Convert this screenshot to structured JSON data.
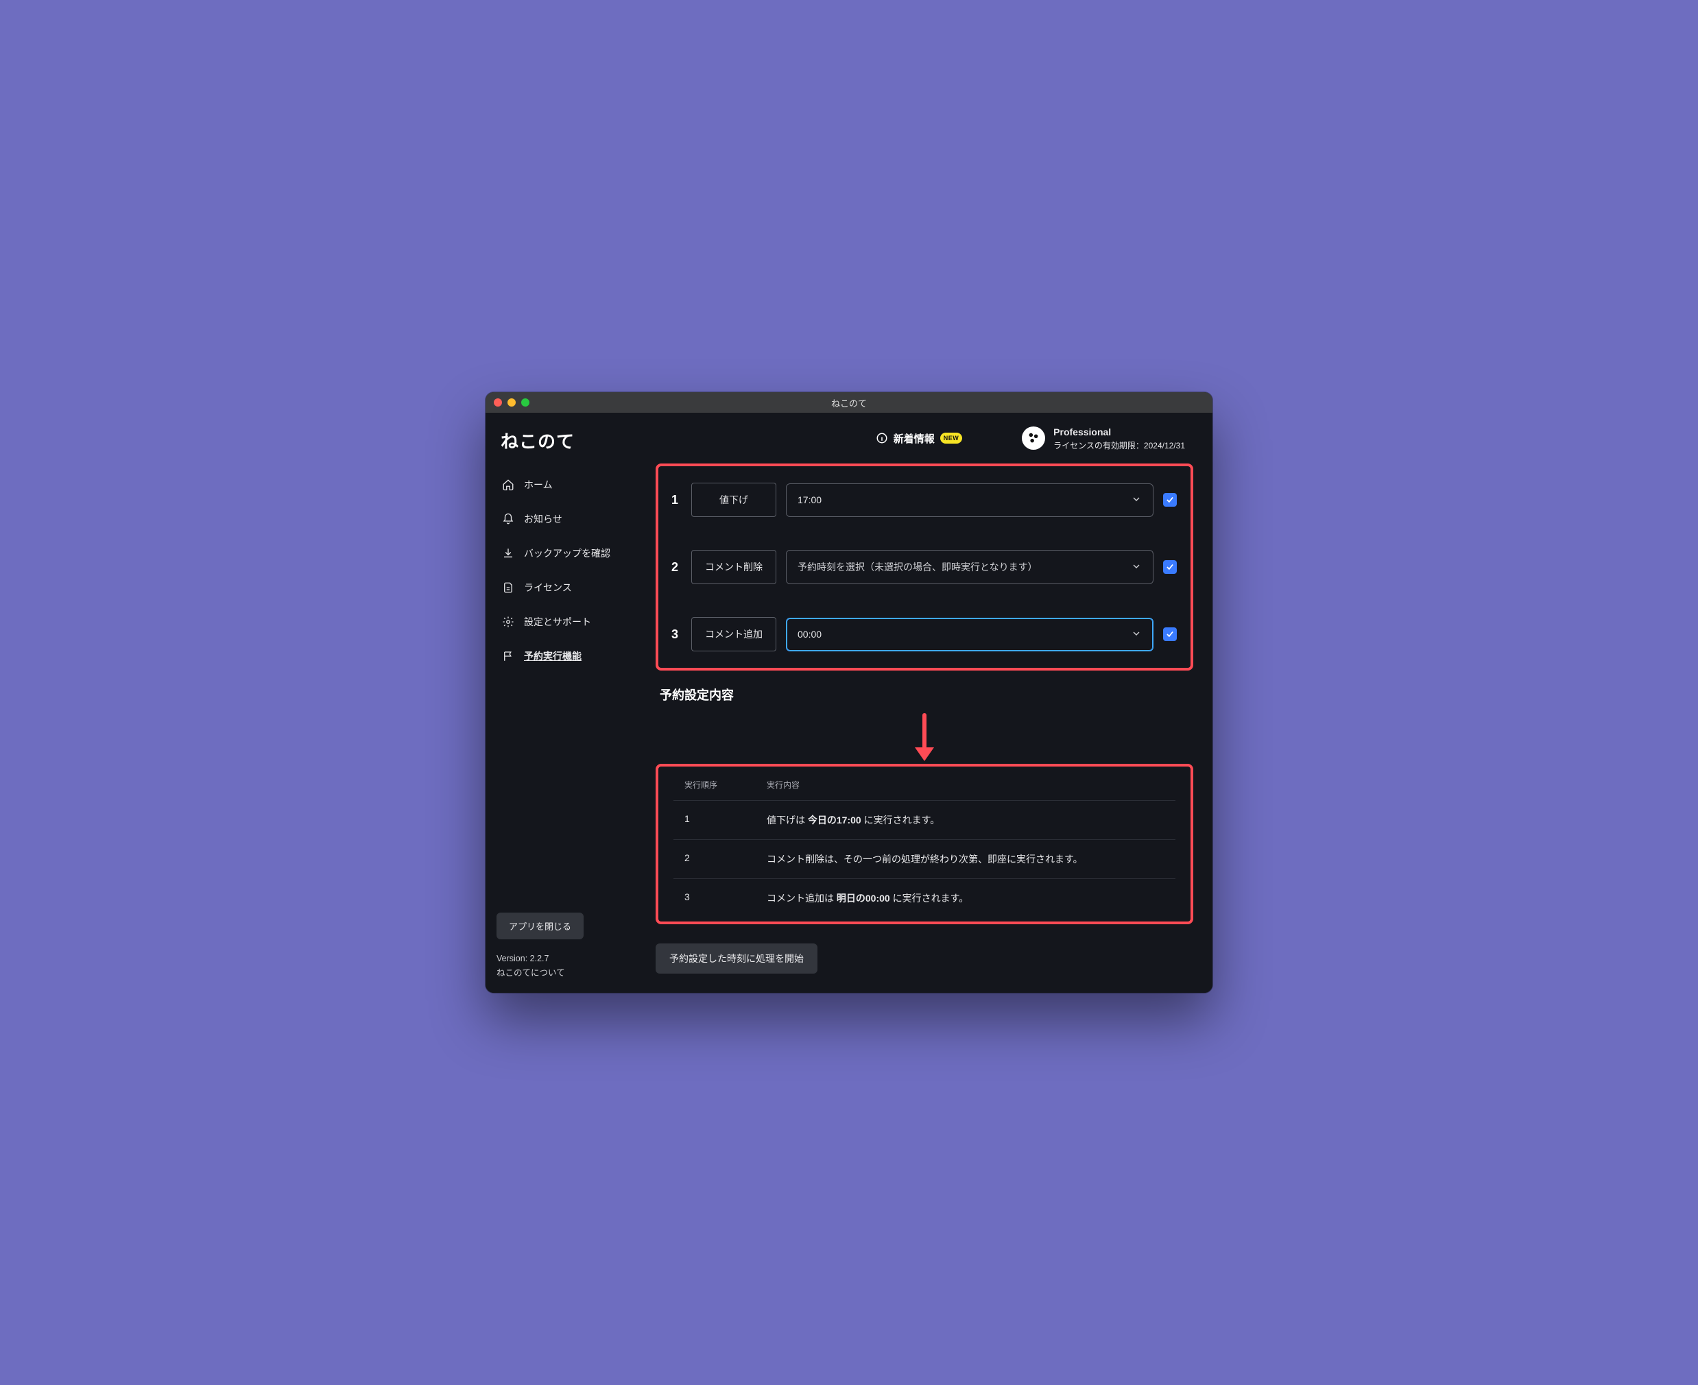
{
  "window": {
    "title": "ねこのて"
  },
  "app": {
    "title": "ねこのて"
  },
  "sidebar": {
    "items": [
      {
        "label": "ホーム"
      },
      {
        "label": "お知らせ"
      },
      {
        "label": "バックアップを確認"
      },
      {
        "label": "ライセンス"
      },
      {
        "label": "設定とサポート"
      },
      {
        "label": "予約実行機能"
      }
    ],
    "close_label": "アプリを閉じる",
    "version_label": "Version: 2.2.7",
    "about_label": "ねこのてについて"
  },
  "header": {
    "news_label": "新着情報",
    "badge": "NEW",
    "plan_name": "Professional",
    "license_expiry": "ライセンスの有効期限：2024/12/31"
  },
  "scheduler": {
    "rows": [
      {
        "num": "1",
        "type": "値下げ",
        "time": "17:00",
        "checked": true,
        "focused": false,
        "placeholder": false
      },
      {
        "num": "2",
        "type": "コメント削除",
        "time": "予約時刻を選択（未選択の場合、即時実行となります）",
        "checked": true,
        "focused": false,
        "placeholder": true
      },
      {
        "num": "3",
        "type": "コメント追加",
        "time": "00:00",
        "checked": true,
        "focused": true,
        "placeholder": false
      }
    ]
  },
  "summary": {
    "title": "予約設定内容",
    "head_order": "実行順序",
    "head_content": "実行内容",
    "rows": [
      {
        "num": "1",
        "text_pre": "値下げは ",
        "text_strong": "今日の17:00",
        "text_post": " に実行されます。"
      },
      {
        "num": "2",
        "text_pre": "コメント削除は、その一つ前の処理が終わり次第、即座に実行されます。",
        "text_strong": "",
        "text_post": ""
      },
      {
        "num": "3",
        "text_pre": "コメント追加は ",
        "text_strong": "明日の00:00",
        "text_post": " に実行されます。"
      }
    ]
  },
  "actions": {
    "start_label": "予約設定した時刻に処理を開始"
  }
}
